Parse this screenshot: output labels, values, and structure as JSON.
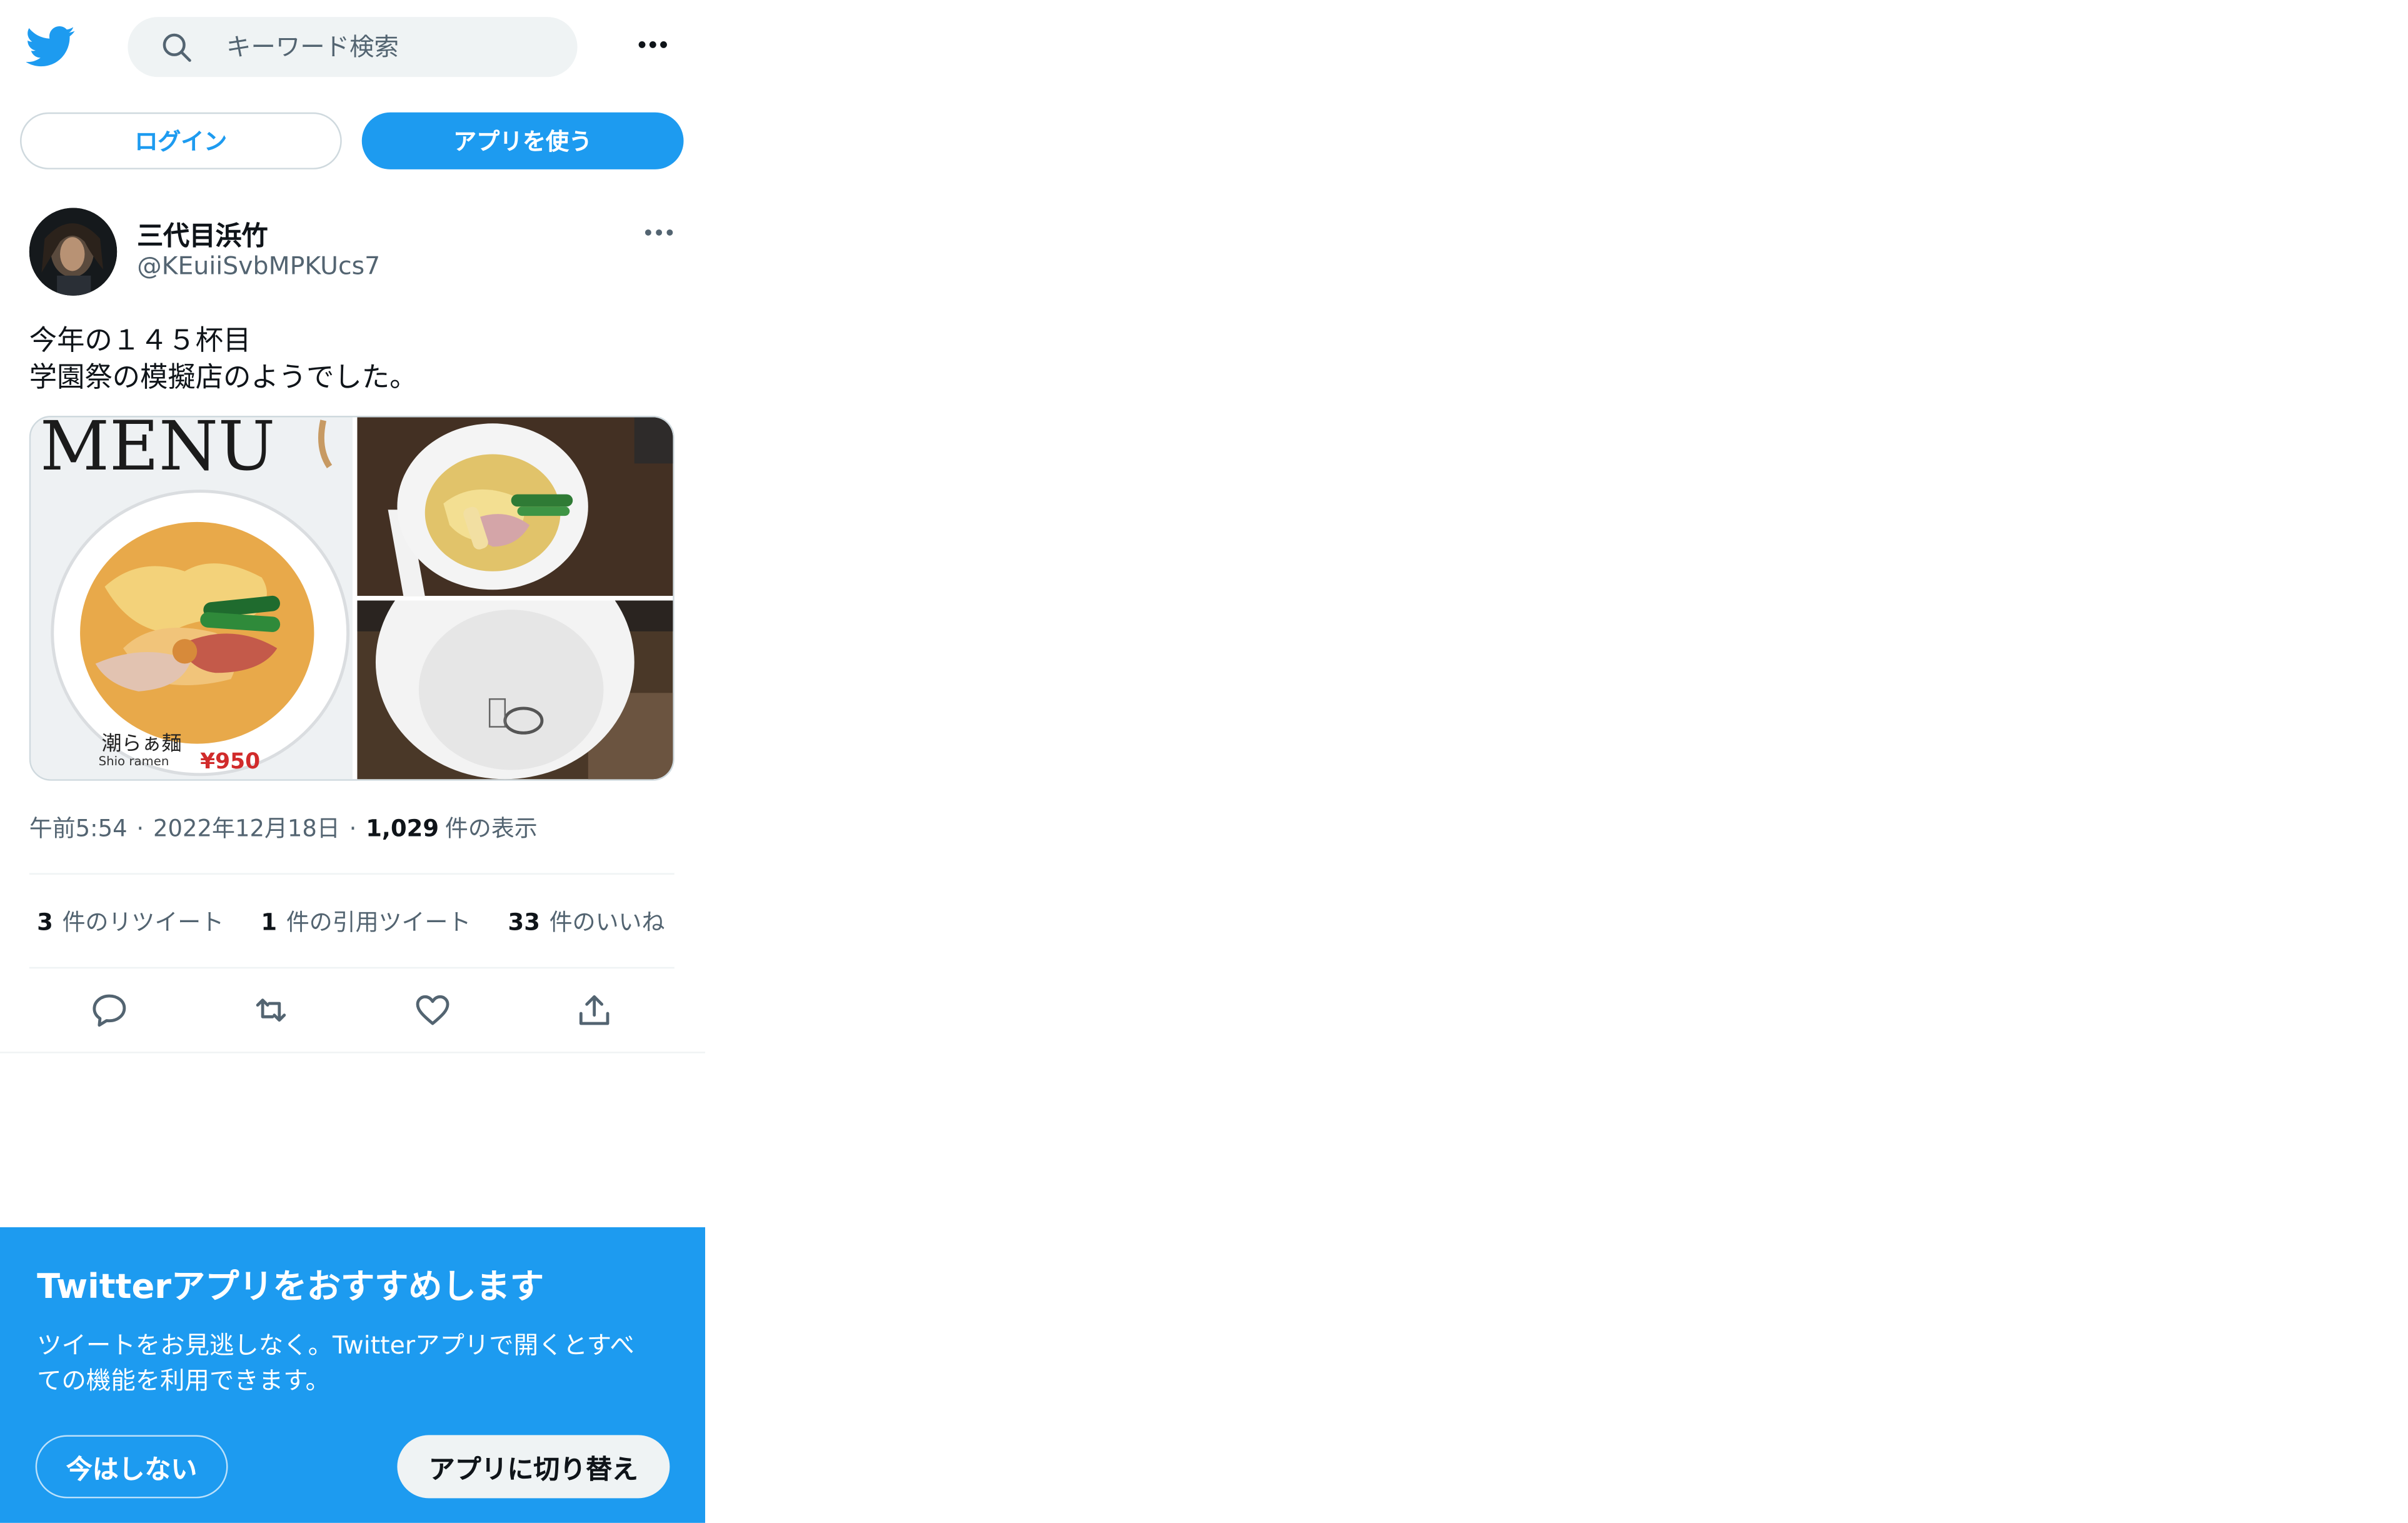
{
  "header": {
    "logo_icon": "twitter-bird-icon",
    "search_placeholder": "キーワード検索",
    "more_icon": "more-horizontal-icon"
  },
  "auth": {
    "login_label": "ログイン",
    "use_app_label": "アプリを使う"
  },
  "tweet": {
    "display_name": "三代目浜竹",
    "handle": "@KEuiiSvbMPKUcs7",
    "text_lines": [
      "今年の１４５杯目",
      "学園祭の模擬店のようでした。"
    ],
    "media": {
      "m1": {
        "headline": "MENU",
        "dish_jp": "潮らぁ麺",
        "dish_en": "Shio ramen",
        "price": "¥950"
      }
    },
    "meta": {
      "time": "午前5:54",
      "date": "2022年12月18日",
      "views_count": "1,029",
      "views_label": "件の表示"
    },
    "stats": [
      {
        "count": "3",
        "label": "件のリツイート"
      },
      {
        "count": "1",
        "label": "件の引用ツイート"
      },
      {
        "count": "33",
        "label": "件のいいね"
      }
    ],
    "actions": [
      "reply-icon",
      "retweet-icon",
      "like-icon",
      "share-icon"
    ]
  },
  "promo": {
    "title": "Twitterアプリをおすすめします",
    "body_lines": [
      "ツイートをお見逃しなく。Twitterアプリで開くとすべ",
      "ての機能を利用できます。"
    ],
    "not_now_label": "今はしない",
    "switch_label": "アプリに切り替え"
  },
  "colors": {
    "accent": "#1d9bf0",
    "text_primary": "#0f1419",
    "text_secondary": "#536471",
    "divider": "#eff3f4"
  }
}
